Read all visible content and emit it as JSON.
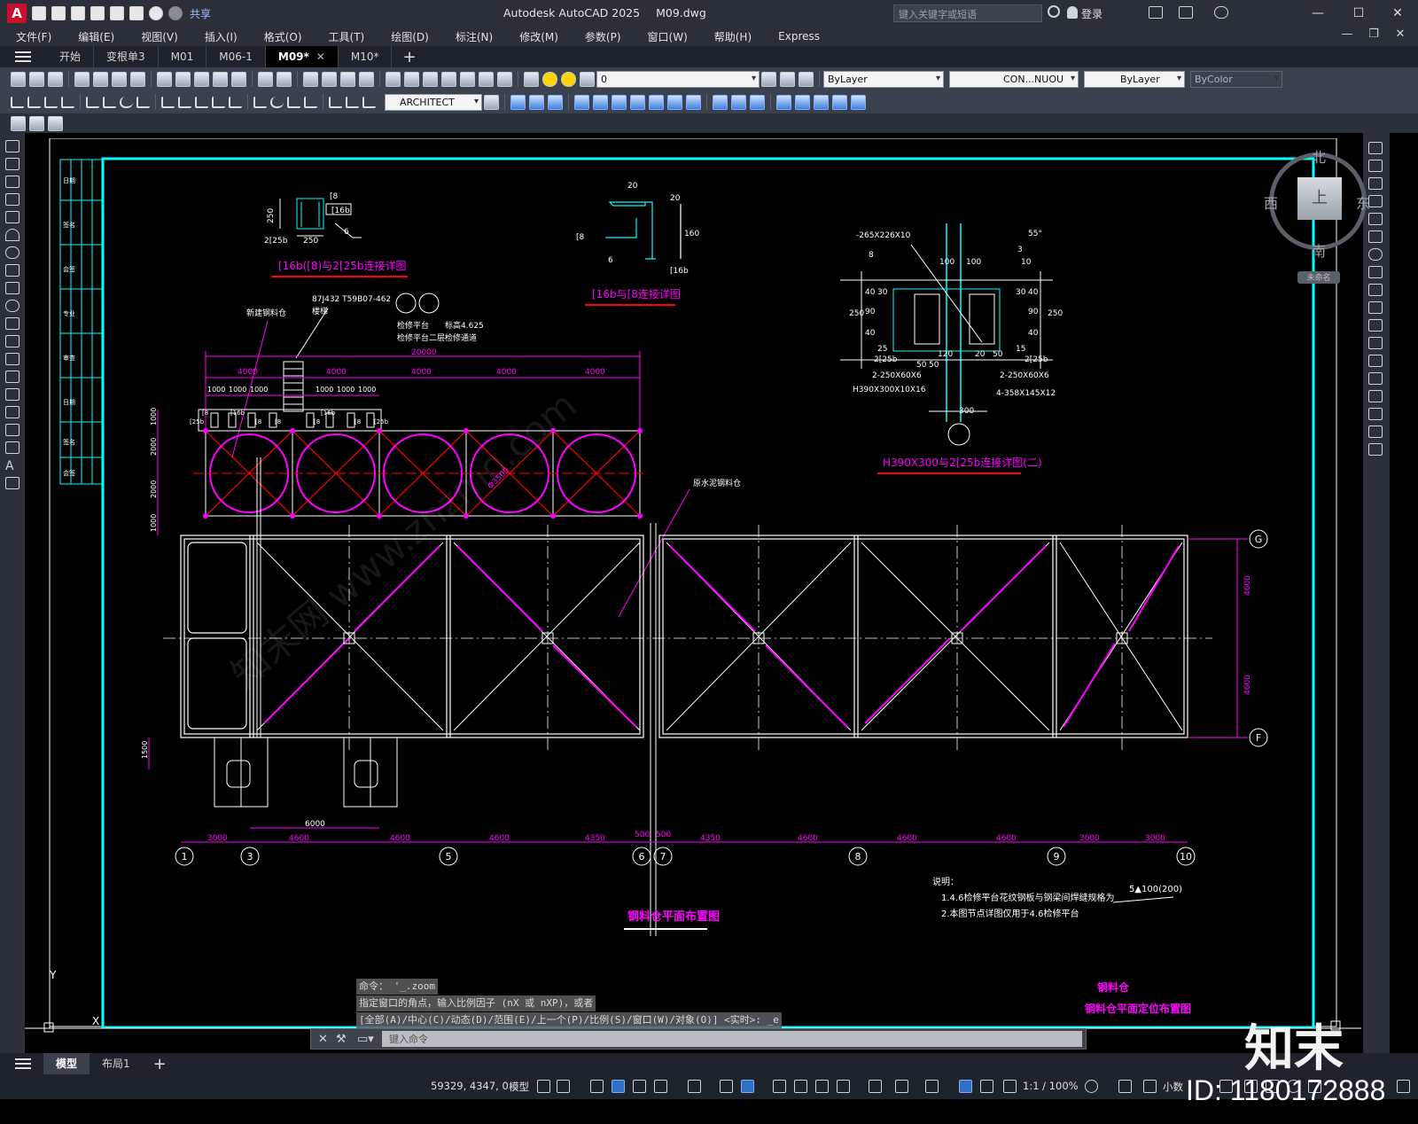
{
  "titlebar": {
    "app_icon": "A",
    "share_label": "共享",
    "app_name": "Autodesk AutoCAD 2025",
    "file_name": "M09.dwg",
    "search_placeholder": "键入关键字或短语",
    "login_label": "登录",
    "icons": [
      "new-icon",
      "open-icon",
      "save-icon",
      "saveas-icon",
      "publish-icon",
      "plot-icon",
      "undo-icon",
      "redo-icon",
      "share-icon",
      "search-icon",
      "user-icon",
      "cart-icon",
      "autodesk-icon",
      "help-icon"
    ]
  },
  "menubar": {
    "items": [
      "文件(F)",
      "编辑(E)",
      "视图(V)",
      "插入(I)",
      "格式(O)",
      "工具(T)",
      "绘图(D)",
      "标注(N)",
      "修改(M)",
      "参数(P)",
      "窗口(W)",
      "帮助(H)",
      "Express"
    ]
  },
  "tabs": {
    "items": [
      "开始",
      "变根单3",
      "M01",
      "M06-1",
      "M09*",
      "M10*"
    ],
    "active_index": 4
  },
  "toolbar2": {
    "layer_value": "0",
    "color_value": "ByLayer",
    "linetype_value": "CON...NUOU",
    "lineweight_value": "ByLayer",
    "plotstyle_value": "ByColor"
  },
  "toolbar3": {
    "dimstyle_value": "ARCHITECT"
  },
  "viewcube": {
    "north": "北",
    "south": "南",
    "east": "东",
    "west": "西",
    "face": "上",
    "wcs": "未命名"
  },
  "drawing": {
    "title_bottom_1": "钢料仓",
    "title_bottom_2": "钢料仓平面定位布置图",
    "plan_title": "钢料仓平面布置图",
    "detail1_title": "[16b([8)与2[25b连接详图",
    "detail2_title": "[16b与[8连接详图",
    "detail3_title": "H390X300与2[25b连接详图(二)",
    "label_new_silo": "新建钢料仓",
    "label_ref": "87J432 T59B07-462",
    "label_stair": "楼梯",
    "label_platform": "检修平台",
    "label_elev": "标高4.625",
    "label_platform2": "检修平台二层检修通道",
    "label_existing": "原水泥钢料仓",
    "label_dia": "Φ3500",
    "notes_title": "说明：",
    "note1": "1.4.6检修平台花纹钢板与钢梁间焊缝规格为",
    "note2": "2.本图节点详图仅用于4.6检修平台",
    "weld_note": "5▲100(200)",
    "total_dim": "20000",
    "top_dims": [
      "4000",
      "4000",
      "4000",
      "4000",
      "4000"
    ],
    "sub_dims": [
      "1000",
      "1000",
      "1000",
      "1000",
      "1000",
      "1000"
    ],
    "left_dims": [
      "1000",
      "2000",
      "2000",
      "1000"
    ],
    "bottom_dims": [
      "3000",
      "4600",
      "4600",
      "4600",
      "4350",
      "500",
      "500",
      "4350",
      "4600",
      "4600",
      "4600",
      "3000",
      "3000"
    ],
    "dim_6000": "6000",
    "dim_1500": "1500",
    "right_dims": [
      "4600",
      "4600"
    ],
    "axes_bottom": [
      "1",
      "3",
      "5",
      "6",
      "7",
      "8",
      "9",
      "10"
    ],
    "axes_right": [
      "G",
      "F"
    ],
    "d3_labels": [
      "-265X226X10",
      "55°",
      "3",
      "8",
      "10",
      "100",
      "100",
      "2[25b",
      "2[25b",
      "2-250X60X6",
      "2-250X60X6",
      "H390X300X10X16",
      "4-358X145X12",
      "300",
      "120",
      "20",
      "50",
      "50",
      "50",
      "250",
      "250",
      "40",
      "90",
      "40",
      "40",
      "90",
      "40",
      "30",
      "30",
      "25",
      "15"
    ],
    "d1_labels": [
      "[8",
      "[16b",
      "250",
      "250",
      "2[25b",
      "6"
    ],
    "d2_labels": [
      "20",
      "20",
      "160",
      "[8",
      "6",
      "[16b"
    ],
    "c8_labels": [
      "[8",
      "[16b",
      "[8",
      "[8",
      "[8",
      "[16b",
      "[8",
      "[25b",
      "[25b"
    ],
    "ucs_y": "Y",
    "ucs_x": "X",
    "tb_cells": [
      "日期",
      "签名",
      "会签",
      "专业",
      "审查",
      "日期",
      "签名",
      "会签"
    ]
  },
  "command": {
    "history": [
      "命令： '_.zoom",
      "指定窗口的角点，输入比例因子 (nX 或 nXP)，或者",
      "[全部(A)/中心(C)/动态(D)/范围(E)/上一个(P)/比例(S)/窗口(W)/对象(O)] <实时>: _e"
    ],
    "placeholder": "键入命令"
  },
  "layout_tabs": {
    "items": [
      "模型",
      "布局1"
    ]
  },
  "status": {
    "coords": "59329, 4347, 0",
    "model": "模型",
    "scale": "1:1 / 100%",
    "units": "小数"
  },
  "watermark": {
    "brand": "知末",
    "id": "ID: 1180172888",
    "diagonal": "知末网 www.znzmo.com"
  },
  "colors": {
    "cyan": "#00ffff",
    "magenta": "#ff00ff",
    "red": "#ff0000",
    "white": "#ffffff"
  }
}
